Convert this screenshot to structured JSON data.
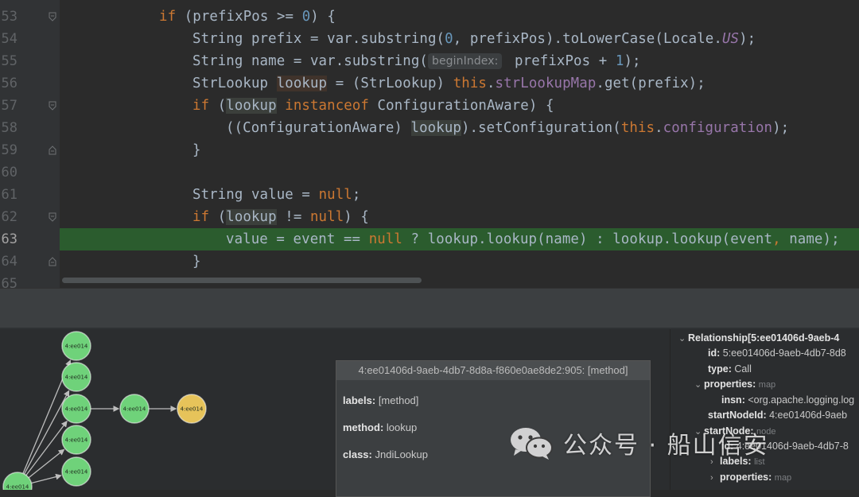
{
  "editor": {
    "lines": [
      {
        "num": "53",
        "parts": [
          [
            "kw",
            "if"
          ],
          [
            "t",
            " (prefixPos >= "
          ],
          [
            "num",
            "0"
          ],
          [
            "t",
            ") {"
          ]
        ]
      },
      {
        "num": "54",
        "parts": [
          [
            "t",
            "String prefix = var.substring("
          ],
          [
            "num",
            "0"
          ],
          [
            "t",
            ", prefixPos).toLowerCase(Locale."
          ],
          [
            "fld-i",
            "US"
          ],
          [
            "t",
            ");"
          ]
        ]
      },
      {
        "num": "55",
        "parts": [
          [
            "t",
            "String name = var.substring("
          ],
          [
            "hint",
            "beginIndex:"
          ],
          [
            "t",
            " prefixPos + "
          ],
          [
            "num",
            "1"
          ],
          [
            "t",
            ");"
          ]
        ]
      },
      {
        "num": "56",
        "parts": [
          [
            "t",
            "StrLookup "
          ],
          [
            "whl",
            "lookup"
          ],
          [
            "t",
            " = (StrLookup) "
          ],
          [
            "kw",
            "this"
          ],
          [
            "t",
            "."
          ],
          [
            "fld",
            "strLookupMap"
          ],
          [
            "t",
            ".get(prefix);"
          ]
        ]
      },
      {
        "num": "57",
        "parts": [
          [
            "kw",
            "if"
          ],
          [
            "t",
            " ("
          ],
          [
            "lhl",
            "lookup"
          ],
          [
            "t",
            " "
          ],
          [
            "kw",
            "instanceof"
          ],
          [
            "t",
            " ConfigurationAware) {"
          ]
        ]
      },
      {
        "num": "58",
        "parts": [
          [
            "t",
            "((ConfigurationAware) "
          ],
          [
            "lhl",
            "lookup"
          ],
          [
            "t",
            ").setConfiguration("
          ],
          [
            "kw",
            "this"
          ],
          [
            "t",
            "."
          ],
          [
            "fld",
            "configuration"
          ],
          [
            "t",
            ");"
          ]
        ]
      },
      {
        "num": "59",
        "parts": [
          [
            "t",
            "}"
          ]
        ]
      },
      {
        "num": "60",
        "parts": []
      },
      {
        "num": "61",
        "parts": [
          [
            "t",
            "String value = "
          ],
          [
            "kw",
            "null"
          ],
          [
            "t",
            ";"
          ]
        ]
      },
      {
        "num": "62",
        "parts": [
          [
            "kw",
            "if"
          ],
          [
            "t",
            " ("
          ],
          [
            "lhl",
            "lookup"
          ],
          [
            "t",
            " != "
          ],
          [
            "kw",
            "null"
          ],
          [
            "t",
            ") {"
          ]
        ]
      },
      {
        "num": "63",
        "parts": [
          [
            "t",
            "value = event == "
          ],
          [
            "kw",
            "null"
          ],
          [
            "t",
            " ? lookup.lookup(name) : lookup.lookup(event"
          ],
          [
            "kw",
            ","
          ],
          [
            "t",
            " name);"
          ]
        ]
      },
      {
        "num": "64",
        "parts": [
          [
            "t",
            "}"
          ]
        ]
      },
      {
        "num": "65",
        "parts": []
      }
    ]
  },
  "graph": {
    "nodes": [
      {
        "label": "4:ee014",
        "color": "#6fd27a"
      },
      {
        "label": "4:ee014",
        "color": "#6fd27a"
      },
      {
        "label": "4:ee014",
        "color": "#6fd27a"
      },
      {
        "label": "4:ee014",
        "color": "#6fd27a"
      },
      {
        "label": "4:ee014",
        "color": "#6fd27a"
      },
      {
        "label": "4:ee014",
        "color": "#6fd27a"
      },
      {
        "label": "4:ee014",
        "color": "#e6c35a"
      },
      {
        "label": "4:ee014",
        "color": "#6fd27a"
      }
    ]
  },
  "popup": {
    "title": "4:ee01406d-9aeb-4db7-8d8a-f860e0ae8de2:905: [method]",
    "rows": [
      {
        "key": "labels",
        "value": " [method]"
      },
      {
        "key": "method",
        "value": " lookup"
      },
      {
        "key": "class",
        "value": " JndiLookup"
      }
    ]
  },
  "tree": {
    "relationship": "Relationship[5:ee01406d-9aeb-4",
    "id_key": "id:",
    "id_val": " 5:ee01406d-9aeb-4db7-8d8",
    "type_key": "type:",
    "type_val": " Call",
    "properties_key": "properties:",
    "properties_type": "map",
    "insn_key": "insn:",
    "insn_val": " <org.apache.logging.log",
    "startNodeId_key": "startNodeId:",
    "startNodeId_val": " 4:ee01406d-9aeb",
    "startNode_key": "startNode:",
    "startNode_type": "node",
    "sn_id_key": "id:",
    "sn_id_val": " 4:ee01406d-9aeb-4db7-8",
    "labels_key": "labels:",
    "labels_type": "list",
    "sn_props_key": "properties:",
    "sn_props_type": "map"
  },
  "watermark": {
    "text": "公众号 · 船山信安"
  }
}
